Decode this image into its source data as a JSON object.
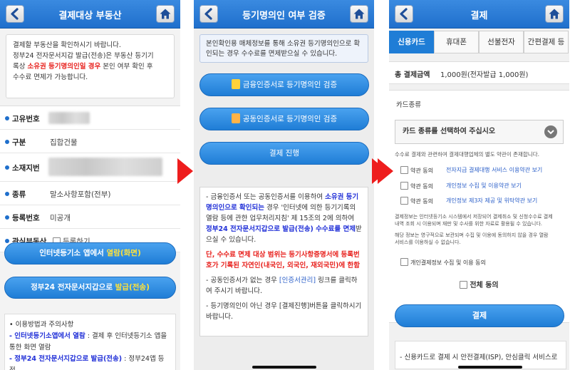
{
  "panel1": {
    "title": "결제대상 부동산",
    "notice_l1": "결제할 부동산을 확인하시기 바랍니다.",
    "notice_l2": "정부24 전자문서지갑 발급(전송)은 부동산 등기기",
    "notice_l3a": "록상 ",
    "notice_l3red": "소유권 등기명의인일 경우",
    "notice_l3b": " 본인 여부 확인 후",
    "notice_l4": "수수료 면제가 가능합니다.",
    "fields": [
      {
        "label": "고유번호",
        "value": ""
      },
      {
        "label": "구분",
        "value": "집합건물"
      },
      {
        "label": "소재지번",
        "value": ""
      },
      {
        "label": "종류",
        "value": "말소사항포함(전부)"
      },
      {
        "label": "등록번호",
        "value": "미공개"
      },
      {
        "label": "관심부동산",
        "value": "등록하기"
      }
    ],
    "btn1_a": "인터넷등기소 앱에서 ",
    "btn1_b": "열람(화면)",
    "btn2_a": "정부24 전자문서지갑으로 ",
    "btn2_b": "발급(전송)",
    "usage_title": "• 이용방법과 주의사항",
    "usage_l1_blue": "- 인터넷등기소앱에서 열람",
    "usage_l1_rest": " : 결제 후 인터넷등기소 앱을",
    "usage_l2": "통한 화면 열람",
    "usage_l3_blue": "- 정부24 전자문서지갑으로 발급(전송)",
    "usage_l3_rest": " : 정부24앱 등 전"
  },
  "panel2": {
    "title": "등기명의인 여부 검증",
    "notice": "본인확인용 매체정보를 통해 소유권 등기명의인으로 확인되는 경우 수수료를 면제받으실 수 있습니다.",
    "btn_financial": "금융인증서로 등기명의인 검증",
    "btn_joint": "공동인증서로 등기명의인 검증",
    "btn_pay": "결제 진행",
    "n1_a": "- 금융인증서 또는 공동인증서를 이용하여 ",
    "n1_blue": "소유권 등기명의인으로 확인되는",
    "n1_b": " 경우 '인터넷에 의한 등기기록의 열람 등에 관한 업무처리지침' 제 15조의 2에 의하여 ",
    "n1_blue2": "정부24 전자문서지갑으로 발급(전송) 수수료를 면제",
    "n1_c": "받으실 수 있습니다.",
    "n2": "단, 수수료 면제 대상 범위는 등기사항증명서에 등록번호가 기록된 자연인(내국인, 외국인, 재외국민)에 한함",
    "n3_a": "- 공동인증서가 없는 경우 ",
    "n3_link": "[인증서관리]",
    "n3_b": " 링크를 클릭하여 주시기 바랍니다.",
    "n4": "- 등기명의인이 아닌 경우 [결제진행]버튼을 클릭하시기 바랍니다."
  },
  "panel3": {
    "title": "결제",
    "tabs": [
      "신용카드",
      "휴대폰",
      "선불전자",
      "간편결제 등"
    ],
    "amount_label": "총 결제금액",
    "amount_value": "1,000원(전자발급 1,000원)",
    "card_type_label": "카드종류",
    "card_select": "카드 종류를 선택하여 주십시오",
    "fee_note": "수수료 결제와 관련하여 결제대행업체의 별도 약관이 존재합니다.",
    "agree_label": "약관 동의",
    "agree_links": [
      "전자지급 결제대행 서비스 이용약관 보기",
      "개인정보 수집 및 이용약관 보기",
      "개인정보 제3자 제공 및 위탁약관 보기"
    ],
    "info_l1": "결제정보는 인터넷등기소 시스템에서 저장되어 결제취소 및 신청수수료 결제",
    "info_l2": "내역 조회 시 이용되며 재판 및 수사를 위한 자료로 활용될 수 있습니다.",
    "info_l3": "해당 정보는 영구적으로 보관되며 수집 및 이용에 동의하지 않을 경우 열람",
    "info_l4": "서비스를 이용하실 수 없습니다.",
    "personal_agree": "개인결제정보 수집 및 이용 동의",
    "all_agree": "전체 동의",
    "pay_btn": "결제",
    "bottom_note": "- 신용카드로 결제 시 안전결제(ISP), 안심클릭 서비스로"
  }
}
